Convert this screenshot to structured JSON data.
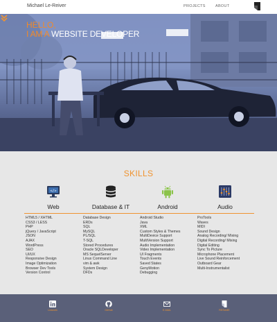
{
  "header": {
    "brand": "Michael Le-Reiver",
    "nav": {
      "projects": "PROJECTS",
      "about": "ABOUT"
    }
  },
  "hero": {
    "line1": "HELLO,",
    "line2_prefix": "I AM A",
    "line2_highlight": "WEBSITE DEVELOPER"
  },
  "skills": {
    "title": "SKILLS",
    "columns": [
      {
        "title": "Web",
        "icon": "code-monitor-icon",
        "items": [
          "HTML5 / XHTML",
          "CSS3 / LESS",
          "PHP",
          "jQuery / JavaScript",
          "JSON",
          "AJAX",
          "WordPress",
          "SEO",
          "UI/UX",
          "Responsive Design",
          "Image Optimization",
          "Browser Dev Tools",
          "Version Control"
        ]
      },
      {
        "title": "Database & IT",
        "icon": "database-icon",
        "items": [
          "Database Design",
          "ERDs",
          "SQL",
          "MySQL",
          "PL/SQL",
          "T-SQL",
          "Stored Procedures",
          "Oracle SQLDeveloper",
          "MS SequelServer",
          "Linux Command Line",
          "vim & awk",
          "System Design",
          "DFDs"
        ]
      },
      {
        "title": "Android",
        "icon": "android-icon",
        "items": [
          "Android Studio",
          "Java",
          "XML",
          "Custom Styles & Themes",
          "MultiDevice Support",
          "MultiVersion Support",
          "Audio Implementation",
          "Video Implementation",
          "UI Fragments",
          "Touch Events",
          "Saved States",
          "GenyMotion",
          "Debugging"
        ]
      },
      {
        "title": "Audio",
        "icon": "mixer-icon",
        "items": [
          "ProTools",
          "Waves",
          "MIDI",
          "Sound Design",
          "Analog Recording/ Mixing",
          "Digital Recording/ Mixing",
          "Digital Editing",
          "Sync To Picture",
          "Microphone Placement",
          "Live Sound Reinforcement",
          "Outboard Gear",
          "Multi-Instrumentalist"
        ]
      }
    ]
  },
  "footer": {
    "items": [
      {
        "label": "LinkedIn",
        "icon": "linkedin-icon"
      },
      {
        "label": "GitHub",
        "icon": "github-icon"
      },
      {
        "label": "E-MAIL",
        "icon": "email-icon"
      },
      {
        "label": "RESUME",
        "icon": "resume-icon"
      }
    ]
  },
  "colors": {
    "accent": "#f0932f",
    "footer": "#5a6079",
    "hero_tint": "#7b8ebf"
  }
}
